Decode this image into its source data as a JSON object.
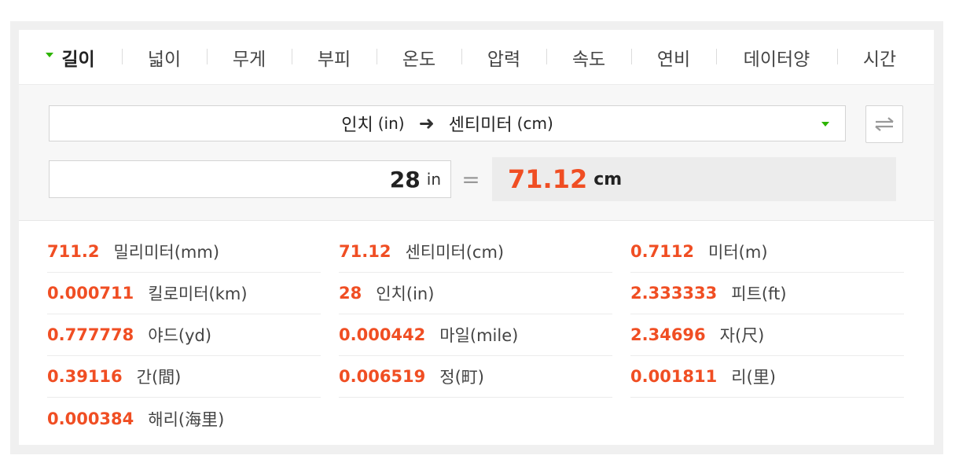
{
  "tabs": [
    {
      "label": "길이",
      "active": true
    },
    {
      "label": "넓이"
    },
    {
      "label": "무게"
    },
    {
      "label": "부피"
    },
    {
      "label": "온도"
    },
    {
      "label": "압력"
    },
    {
      "label": "속도"
    },
    {
      "label": "연비"
    },
    {
      "label": "데이터양"
    },
    {
      "label": "시간"
    }
  ],
  "selector": {
    "from_name": "인치",
    "from_abbr": "(in)",
    "arrow": "➜",
    "to_name": "센티미터",
    "to_abbr": "(cm)"
  },
  "input": {
    "value": "28",
    "unit": "in"
  },
  "equals": "=",
  "result": {
    "value": "71.12",
    "unit": "cm"
  },
  "conversions": [
    {
      "value": "711.2",
      "name": "밀리미터(mm)"
    },
    {
      "value": "71.12",
      "name": "센티미터(cm)"
    },
    {
      "value": "0.7112",
      "name": "미터(m)"
    },
    {
      "value": "0.000711",
      "name": "킬로미터(km)"
    },
    {
      "value": "28",
      "name": "인치(in)"
    },
    {
      "value": "2.333333",
      "name": "피트(ft)"
    },
    {
      "value": "0.777778",
      "name": "야드(yd)"
    },
    {
      "value": "0.000442",
      "name": "마일(mile)"
    },
    {
      "value": "2.34696",
      "name": "자(尺)"
    },
    {
      "value": "0.39116",
      "name": "간(間)"
    },
    {
      "value": "0.006519",
      "name": "정(町)"
    },
    {
      "value": "0.001811",
      "name": "리(里)"
    },
    {
      "value": "0.000384",
      "name": "해리(海里)"
    }
  ],
  "colors": {
    "accent": "#2db400",
    "result": "#f04e23"
  }
}
